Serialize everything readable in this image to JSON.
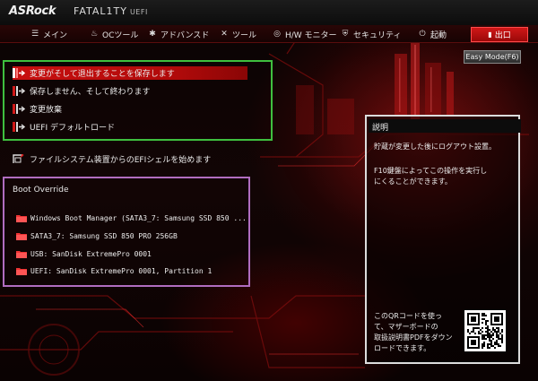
{
  "header": {
    "brand": "ASRock",
    "series": "FATAL1TY",
    "uefi": "UEFI"
  },
  "nav": {
    "items": [
      {
        "label": "メイン",
        "icon": "list-icon"
      },
      {
        "label": "OCツール",
        "icon": "flame-icon"
      },
      {
        "label": "アドバンスド",
        "icon": "star-icon"
      },
      {
        "label": "ツール",
        "icon": "tools-icon"
      },
      {
        "label": "H/W モニター",
        "icon": "monitor-icon"
      },
      {
        "label": "セキュリティ",
        "icon": "shield-icon"
      },
      {
        "label": "起動",
        "icon": "power-icon"
      }
    ],
    "exit_label": "出口"
  },
  "easy_mode_label": "Easy Mode(F6)",
  "exit_menu": {
    "items": [
      "変更がそして退出することを保存します",
      "保存しません、そして終わります",
      "変更放棄",
      "UEFI デフォルトロード"
    ],
    "selected_index": 0,
    "efi_shell": "ファイルシステム装置からのEFIシェルを始めます"
  },
  "boot_override": {
    "title": "Boot Override",
    "items": [
      "Windows Boot Manager (SATA3_7: Samsung SSD 850 ...",
      "SATA3_7: Samsung SSD 850 PRO 256GB",
      "USB: SanDisk ExtremePro 0001",
      "UEFI: SanDisk ExtremePro 0001, Partition 1"
    ]
  },
  "description": {
    "title": "説明",
    "line1": "貯蔵が変更した後にログアウト設置。",
    "line2a": "F10鍵盤によってこの操作を実行し",
    "line2b": "にくることができます。",
    "qr_line1": "このQRコードを使っ",
    "qr_line2": "て、マザーボードの",
    "qr_line3": "取扱説明書PDFをダウン",
    "qr_line4": "ロードできます。"
  },
  "colors": {
    "accent_red": "#c81010",
    "highlight_green": "#3fbf3f",
    "highlight_purple": "#b06dc0"
  }
}
